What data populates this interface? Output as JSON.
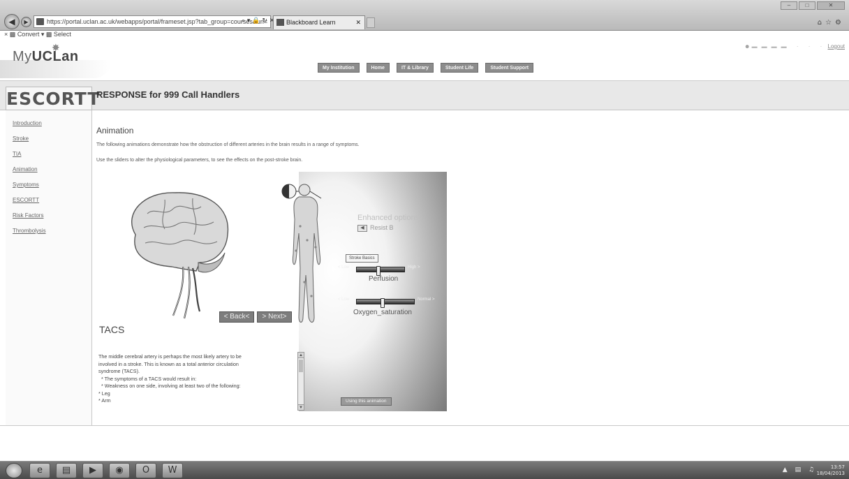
{
  "browser": {
    "url": "https://portal.uclan.ac.uk/webapps/portal/frameset.jsp?tab_group=courses&url=",
    "tab_title": "Blackboard Learn",
    "toolbar_convert": "Convert",
    "toolbar_select": "Select"
  },
  "portal": {
    "logo_prefix": "My",
    "logo_bold": "UCLan",
    "nav": [
      "My Institution",
      "Home",
      "IT & Library",
      "Student Life",
      "Student Support"
    ],
    "logout": "Logout"
  },
  "module": {
    "logo": "ESCORTT",
    "title": "RESPONSE for 999 Call Handlers"
  },
  "sidebar": {
    "items": [
      "Introduction",
      "Stroke",
      "TIA",
      "Animation",
      "Symptoms",
      "ESCORTT",
      "Risk Factors",
      "Thrombolysis"
    ]
  },
  "content": {
    "heading": "Animation",
    "intro_1": "The following animations demonstrate how the obstruction of different arteries in the brain results in a range of symptoms.",
    "intro_2": "Use the sliders to alter the physiological parameters, to see the effects on the post-stroke brain."
  },
  "animation": {
    "back_label": "< Back<",
    "next_label": "> Next>",
    "heading": "TACS",
    "text_lines": [
      "The middle cerebral artery is perhaps the most likely artery to be",
      "involved in a stroke. This is known as a total anterior circulation",
      "syndrome (TACS).",
      "* The symptoms of a TACS would result in:",
      "* Weakness on one side, involving at least two of the following:",
      "* Leg",
      "* Arm"
    ],
    "options_title": "Enhanced options",
    "resist_label": "Resist B",
    "stroke_basics": "Stroke Basics",
    "perfusion": {
      "low": "< Low",
      "high": "High >",
      "caption": "Perfusion",
      "level": 0.45
    },
    "oxygen": {
      "low": "< Low",
      "high": "Normal >",
      "caption": "Oxygen_saturation",
      "level": 0.45
    },
    "using_label": "Using this animation"
  },
  "taskbar": {
    "time": "13:57",
    "date": "18/04/2013"
  }
}
